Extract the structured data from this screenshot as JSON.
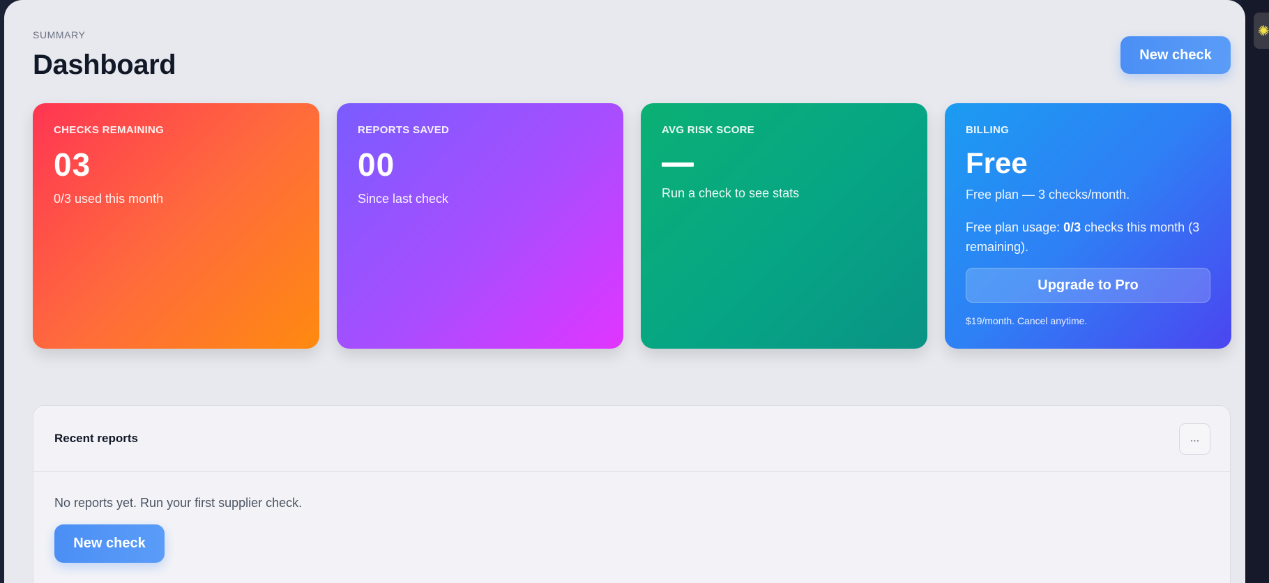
{
  "header": {
    "eyebrow": "SUMMARY",
    "title": "Dashboard",
    "new_check_label": "New check"
  },
  "cards": {
    "checks_remaining": {
      "label": "CHECKS REMAINING",
      "value": "03",
      "sub": "0/3 used this month"
    },
    "reports_saved": {
      "label": "REPORTS SAVED",
      "value": "00",
      "sub": "Since last check"
    },
    "avg_risk_score": {
      "label": "AVG RISK SCORE",
      "value": "—",
      "sub": "Run a check to see stats"
    },
    "billing": {
      "label": "BILLING",
      "value": "Free",
      "plan": "Free plan — 3 checks/month.",
      "usage_prefix": "Free plan usage: ",
      "usage_value": "0/3",
      "usage_suffix": " checks this month (3 remaining).",
      "upgrade_label": "Upgrade to Pro",
      "note": "$19/month. Cancel anytime."
    }
  },
  "reports": {
    "title": "Recent reports",
    "more_label": "...",
    "empty_text": "No reports yet. Run your first supplier check.",
    "new_check_label": "New check"
  },
  "icons": {
    "more": "more-horizontal-icon",
    "widget": "sun-icon"
  },
  "colors": {
    "accent": "#4b8ff5",
    "card_red": "#ff3553",
    "card_purple": "#a94dff",
    "card_green": "#06a585",
    "card_blue": "#2f7ff5",
    "widget_yellow": "#f5e34a"
  }
}
